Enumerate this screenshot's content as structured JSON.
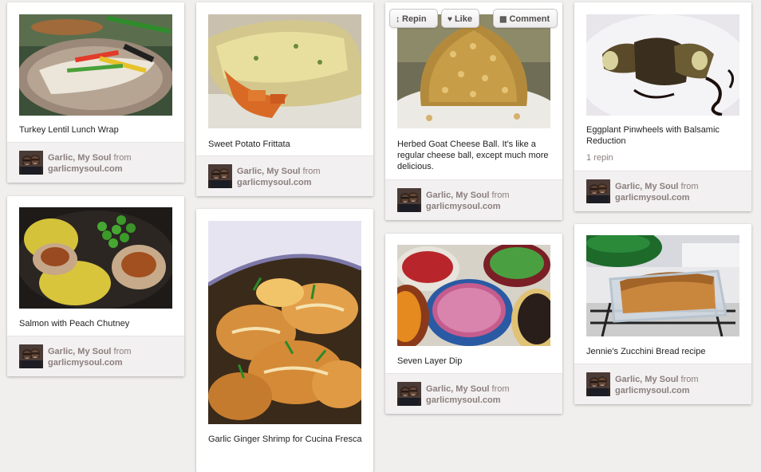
{
  "from_label": "from",
  "actions": {
    "repin_label": "Repin",
    "like_label": "Like",
    "comment_label": "Comment"
  },
  "pins": [
    {
      "description": "Turkey Lentil Lunch Wrap",
      "pinner": "Garlic, My Soul",
      "source": "garlicmysoul.com",
      "image_subject": "lentil wrap with vegetables"
    },
    {
      "description": "Salmon with Peach Chutney",
      "pinner": "Garlic, My Soul",
      "source": "garlicmysoul.com",
      "image_subject": "salmon with peach chutney and peas"
    },
    {
      "description": "Sweet Potato Frittata",
      "pinner": "Garlic, My Soul",
      "source": "garlicmysoul.com",
      "image_subject": "sweet potato frittata slice"
    },
    {
      "description": "Garlic Ginger Shrimp for Cucina Fresca",
      "pinner": "Garlic, My Soul",
      "source": "garlicmysoul.com",
      "image_subject": "garlic ginger shrimp"
    },
    {
      "description": "Herbed Goat Cheese Ball. It's like a regular cheese ball, except much more delicious.",
      "pinner": "Garlic, My Soul",
      "source": "garlicmysoul.com",
      "image_subject": "goat cheese ball with pine nuts"
    },
    {
      "description": "Seven Layer Dip",
      "pinner": "Garlic, My Soul",
      "source": "garlicmysoul.com",
      "image_subject": "bowls of dip ingredients"
    },
    {
      "description": "Eggplant Pinwheels with Balsamic Reduction",
      "stats": "1 repin",
      "pinner": "Garlic, My Soul",
      "source": "garlicmysoul.com",
      "image_subject": "eggplant pinwheels with balsamic"
    },
    {
      "description": "Jennie's Zucchini Bread recipe",
      "pinner": "Garlic, My Soul",
      "source": "garlicmysoul.com",
      "image_subject": "zucchini bread in glass loaf pan"
    }
  ]
}
